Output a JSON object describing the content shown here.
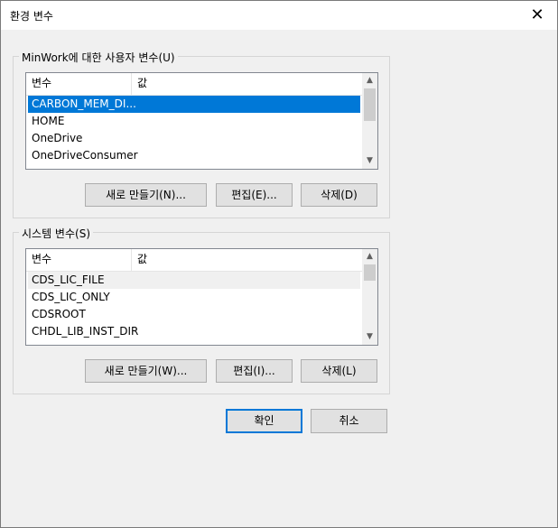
{
  "window": {
    "title": "환경 변수",
    "close_glyph": "✕"
  },
  "user_vars": {
    "group_label": "MinWork에 대한 사용자 변수(U)",
    "columns": [
      "변수",
      "값"
    ],
    "rows": [
      {
        "name": "CARBON_MEM_DI...",
        "value": ""
      },
      {
        "name": "HOME",
        "value": ""
      },
      {
        "name": "OneDrive",
        "value": ""
      },
      {
        "name": "OneDriveConsumer",
        "value": ""
      }
    ],
    "selected_index": 0,
    "buttons": {
      "new": "새로 만들기(N)...",
      "edit": "편집(E)...",
      "delete": "삭제(D)"
    }
  },
  "system_vars": {
    "group_label": "시스템 변수(S)",
    "columns": [
      "변수",
      "값"
    ],
    "rows": [
      {
        "name": "CDS_LIC_FILE",
        "value": ""
      },
      {
        "name": "CDS_LIC_ONLY",
        "value": ""
      },
      {
        "name": "CDSROOT",
        "value": ""
      },
      {
        "name": "CHDL_LIB_INST_DIR",
        "value": ""
      }
    ],
    "hover_index": 0,
    "buttons": {
      "new": "새로 만들기(W)...",
      "edit": "편집(I)...",
      "delete": "삭제(L)"
    }
  },
  "footer": {
    "ok": "확인",
    "cancel": "취소"
  },
  "icons": {
    "scroll_up": "chevron-up-icon",
    "scroll_down": "chevron-down-icon",
    "close": "close-icon"
  },
  "colors": {
    "selection": "#0078d7",
    "default_button_border": "#0078d7"
  }
}
